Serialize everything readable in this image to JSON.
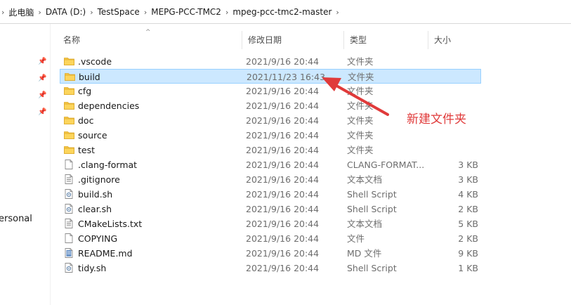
{
  "breadcrumb": {
    "items": [
      "此电脑",
      "DATA (D:)",
      "TestSpace",
      "MEPG-PCC-TMC2",
      "mpeg-pcc-tmc2-master"
    ]
  },
  "nav": {
    "partial_label": "ersonal"
  },
  "columns": {
    "name": "名称",
    "date": "修改日期",
    "type": "类型",
    "size": "大小"
  },
  "files": [
    {
      "name": ".vscode",
      "date": "2021/9/16 20:44",
      "type": "文件夹",
      "size": "",
      "icon": "folder-icon"
    },
    {
      "name": "build",
      "date": "2021/11/23 16:43",
      "type": "文件夹",
      "size": "",
      "icon": "folder-icon"
    },
    {
      "name": "cfg",
      "date": "2021/9/16 20:44",
      "type": "文件夹",
      "size": "",
      "icon": "folder-icon"
    },
    {
      "name": "dependencies",
      "date": "2021/9/16 20:44",
      "type": "文件夹",
      "size": "",
      "icon": "folder-icon"
    },
    {
      "name": "doc",
      "date": "2021/9/16 20:44",
      "type": "文件夹",
      "size": "",
      "icon": "folder-icon"
    },
    {
      "name": "source",
      "date": "2021/9/16 20:44",
      "type": "文件夹",
      "size": "",
      "icon": "folder-icon"
    },
    {
      "name": "test",
      "date": "2021/9/16 20:44",
      "type": "文件夹",
      "size": "",
      "icon": "folder-icon"
    },
    {
      "name": ".clang-format",
      "date": "2021/9/16 20:44",
      "type": "CLANG-FORMAT...",
      "size": "3 KB",
      "icon": "file-icon"
    },
    {
      "name": ".gitignore",
      "date": "2021/9/16 20:44",
      "type": "文本文档",
      "size": "3 KB",
      "icon": "text-file-icon"
    },
    {
      "name": "build.sh",
      "date": "2021/9/16 20:44",
      "type": "Shell Script",
      "size": "4 KB",
      "icon": "script-file-icon"
    },
    {
      "name": "clear.sh",
      "date": "2021/9/16 20:44",
      "type": "Shell Script",
      "size": "2 KB",
      "icon": "script-file-icon"
    },
    {
      "name": "CMakeLists.txt",
      "date": "2021/9/16 20:44",
      "type": "文本文档",
      "size": "5 KB",
      "icon": "text-file-icon"
    },
    {
      "name": "COPYING",
      "date": "2021/9/16 20:44",
      "type": "文件",
      "size": "2 KB",
      "icon": "file-icon"
    },
    {
      "name": "README.md",
      "date": "2021/9/16 20:44",
      "type": "MD 文件",
      "size": "9 KB",
      "icon": "md-file-icon"
    },
    {
      "name": "tidy.sh",
      "date": "2021/9/16 20:44",
      "type": "Shell Script",
      "size": "1 KB",
      "icon": "script-file-icon"
    }
  ],
  "selected_index": 1,
  "annotation": {
    "text": "新建文件夹",
    "color": "#e03a3a"
  },
  "colors": {
    "selection_bg": "#cce8ff",
    "selection_border": "#99d1ff",
    "folder": "#f7c744"
  }
}
